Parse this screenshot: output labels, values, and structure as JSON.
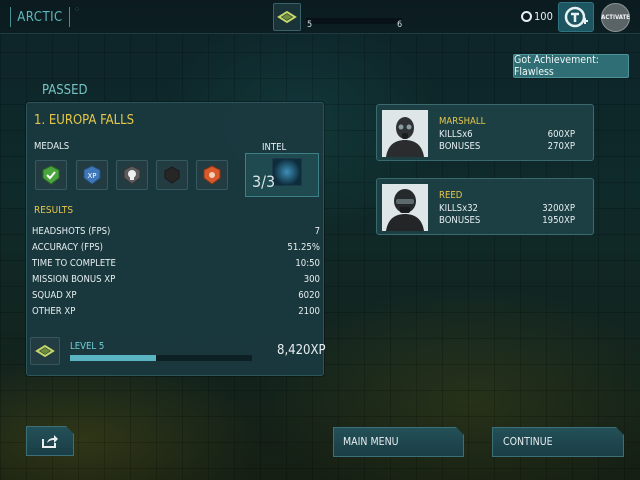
{
  "topbar": {
    "world": "ARCTIC",
    "level_current": "5",
    "level_next": "6",
    "credits": "100",
    "activate_label": "ACTIVATE"
  },
  "achievement": "Got Achievement: Flawless",
  "status": "PASSED",
  "mission": {
    "title": "1. EUROPA FALLS",
    "medals_label": "MEDALS",
    "intel_label": "INTEL",
    "intel_count": "3/3",
    "medals": [
      {
        "icon": "check-medal-icon",
        "color": "#4aa63c"
      },
      {
        "icon": "xp-medal-icon",
        "color": "#3f78b8"
      },
      {
        "icon": "skull-medal-icon",
        "color": "#6e6e6e"
      },
      {
        "icon": "dark-medal-icon",
        "color": "#2a2a2a"
      },
      {
        "icon": "orange-medal-icon",
        "color": "#d8592a"
      }
    ],
    "results_label": "RESULTS",
    "results": [
      {
        "k": "HEADSHOTS (FPS)",
        "v": "7"
      },
      {
        "k": "ACCURACY (FPS)",
        "v": "51.25%"
      },
      {
        "k": "TIME TO COMPLETE",
        "v": "10:50"
      },
      {
        "k": "MISSION BONUS XP",
        "v": "300"
      },
      {
        "k": "SQUAD XP",
        "v": "6020"
      },
      {
        "k": "OTHER XP",
        "v": "2100"
      }
    ],
    "level_label": "LEVEL 5",
    "level_progress": 0.47,
    "total_xp": "8,420XP"
  },
  "squad": [
    {
      "name": "MARSHALL",
      "kills": "KILLSx6",
      "kills_xp": "600XP",
      "bonuses": "BONUSES",
      "bonuses_xp": "270XP"
    },
    {
      "name": "REED",
      "kills": "KILLSx32",
      "kills_xp": "3200XP",
      "bonuses": "BONUSES",
      "bonuses_xp": "1950XP"
    }
  ],
  "buttons": {
    "main_menu": "MAIN MENU",
    "continue": "CONTINUE"
  },
  "colors": {
    "accent_gold": "#e6c64a",
    "accent_teal": "#5ab4c4"
  }
}
